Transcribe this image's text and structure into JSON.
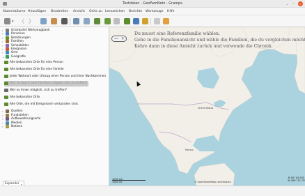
{
  "window": {
    "title": "Testdaten - GeoFamNetz - Gramps",
    "buttons": {
      "minimize": "⌄",
      "maximize": "⌃",
      "close": "×"
    }
  },
  "menubar": {
    "items": [
      "Stammbäume",
      "Hinzufügen",
      "Bearbeiten",
      "Ansicht",
      "Gehe zu",
      "Lesezeichen",
      "Berichte",
      "Werkzeuge",
      "Hilfe"
    ]
  },
  "toolbar": {
    "icons": [
      "tree-edit-icon",
      "chevron-down-icon",
      "back-icon",
      "forward-icon",
      "home-icon",
      "persons-icon",
      "print-icon",
      "add-icon",
      "edit-icon",
      "places-icon",
      "family-map-icon",
      "geo-view-icon",
      "geo-places-icon",
      "people-view-icon",
      "events-view-icon",
      "config-icon",
      "bookmarks-icon"
    ],
    "active_icon": "geo-view-icon"
  },
  "sidebar": {
    "tree_top": [
      {
        "label": "Grampslet Werkzeugbank",
        "icon": "toolbox-icon",
        "color": "#7a7a7a"
      },
      {
        "label": "Personen",
        "icon": "person-icon",
        "color": "#4a7bb7"
      },
      {
        "label": "Beziehungen",
        "icon": "relationship-icon",
        "color": "#6b8e23"
      },
      {
        "label": "Familien",
        "icon": "family-icon",
        "color": "#9c6b30"
      },
      {
        "label": "Schaubilder",
        "icon": "chart-icon",
        "color": "#8a6bb0"
      },
      {
        "label": "Ereignisse",
        "icon": "event-icon",
        "color": "#c65d3b"
      },
      {
        "label": "Orte",
        "icon": "place-icon",
        "color": "#3b8ac6"
      },
      {
        "label": "Geografie",
        "icon": "globe-icon",
        "color": "#3a9a5a"
      }
    ],
    "gramplets": [
      {
        "label": "Alle bekannten Orte für eine Person",
        "state": "normal"
      },
      {
        "label": "Alle bekannten Orte für eine Familie",
        "state": "normal"
      },
      {
        "label": "Jeder Wohnort oder Umzug einer Person und ihrer Nachkommen",
        "state": "normal"
      },
      {
        "label": "Wer ist durch zwei Familien möglich sich zu treffen?",
        "state": "selected"
      },
      {
        "label": "Wer es ihnen möglich, sich zu treffen?",
        "state": "normal"
      },
      {
        "label": "Alle bekannten Orte",
        "state": "normal"
      },
      {
        "label": "Alle Orte, die mit Ereignissen verbunden sind.",
        "state": "normal"
      }
    ],
    "tree_bottom": [
      {
        "label": "Quellen",
        "icon": "source-icon",
        "color": "#7a6b50"
      },
      {
        "label": "Fundstellen",
        "icon": "citation-icon",
        "color": "#9a7b40"
      },
      {
        "label": "Aufbewahrungsorte",
        "icon": "repository-icon",
        "color": "#6a5a8a"
      },
      {
        "label": "Medien",
        "icon": "media-icon",
        "color": "#4a8ab0"
      },
      {
        "label": "Notizen",
        "icon": "note-icon",
        "color": "#b09a40"
      }
    ],
    "expander": {
      "label": "Expander",
      "chevron": "⌄"
    }
  },
  "map": {
    "message_lines": [
      "Du musst eine Referenzfamilie wählen.",
      "Gehe in die Familienansicht und wähle die Familien, die du vergleichen möchtest.",
      "Kehre dann in diese Ansicht zurück und verwende die Chronik."
    ],
    "zoom": {
      "minus": "—",
      "plus": "+"
    },
    "labels": {
      "us": "United States",
      "mexico": "Mexico"
    },
    "scale": {
      "upper": "1000 km",
      "lower": "1000 mi"
    },
    "attribution": "© OpenStreetMap contributors",
    "coords": {
      "lat": "N 38° 04.505",
      "lon": "W 098° 32.755"
    },
    "colors": {
      "water": "#aad3df",
      "land": "#f2efe9",
      "border": "#b7a5c7"
    }
  }
}
